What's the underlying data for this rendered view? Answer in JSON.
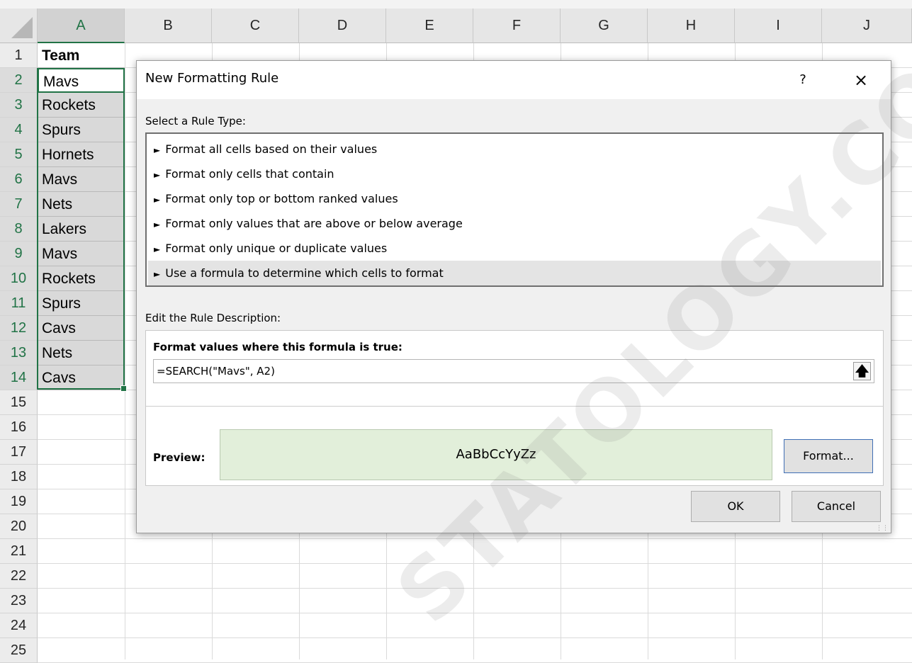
{
  "spreadsheet": {
    "columns": [
      "A",
      "B",
      "C",
      "D",
      "E",
      "F",
      "G",
      "H",
      "I",
      "J"
    ],
    "selected_column": "A",
    "rows": [
      "1",
      "2",
      "3",
      "4",
      "5",
      "6",
      "7",
      "8",
      "9",
      "10",
      "11",
      "12",
      "13",
      "14",
      "15",
      "16",
      "17",
      "18",
      "19",
      "20",
      "21",
      "22",
      "23",
      "24",
      "25"
    ],
    "selected_rows": [
      "2",
      "3",
      "4",
      "5",
      "6",
      "7",
      "8",
      "9",
      "10",
      "11",
      "12",
      "13",
      "14"
    ],
    "column_a": [
      "Team",
      "Mavs",
      "Rockets",
      "Spurs",
      "Hornets",
      "Mavs",
      "Nets",
      "Lakers",
      "Mavs",
      "Rockets",
      "Spurs",
      "Cavs",
      "Nets",
      "Cavs"
    ],
    "header_cell_bold": true,
    "selection_color": "#217346"
  },
  "dialog": {
    "title": "New Formatting Rule",
    "help_label": "?",
    "close_label": "×",
    "select_rule_type_label": "Select a Rule Type:",
    "rule_types": [
      "Format all cells based on their values",
      "Format only cells that contain",
      "Format only top or bottom ranked values",
      "Format only values that are above or below average",
      "Format only unique or duplicate values",
      "Use a formula to determine which cells to format"
    ],
    "selected_rule_index": 5,
    "edit_description_label": "Edit the Rule Description:",
    "formula_label": "Format values where this formula is true:",
    "formula_value": "=SEARCH(\"Mavs\", A2)",
    "collapse_icon": "up-arrow-icon",
    "preview_label": "Preview:",
    "preview_text": "AaBbCcYyZz",
    "preview_fill_color": "#e2efda",
    "format_button": "Format...",
    "ok_button": "OK",
    "cancel_button": "Cancel"
  },
  "watermark": "STATOLOGY.COM"
}
